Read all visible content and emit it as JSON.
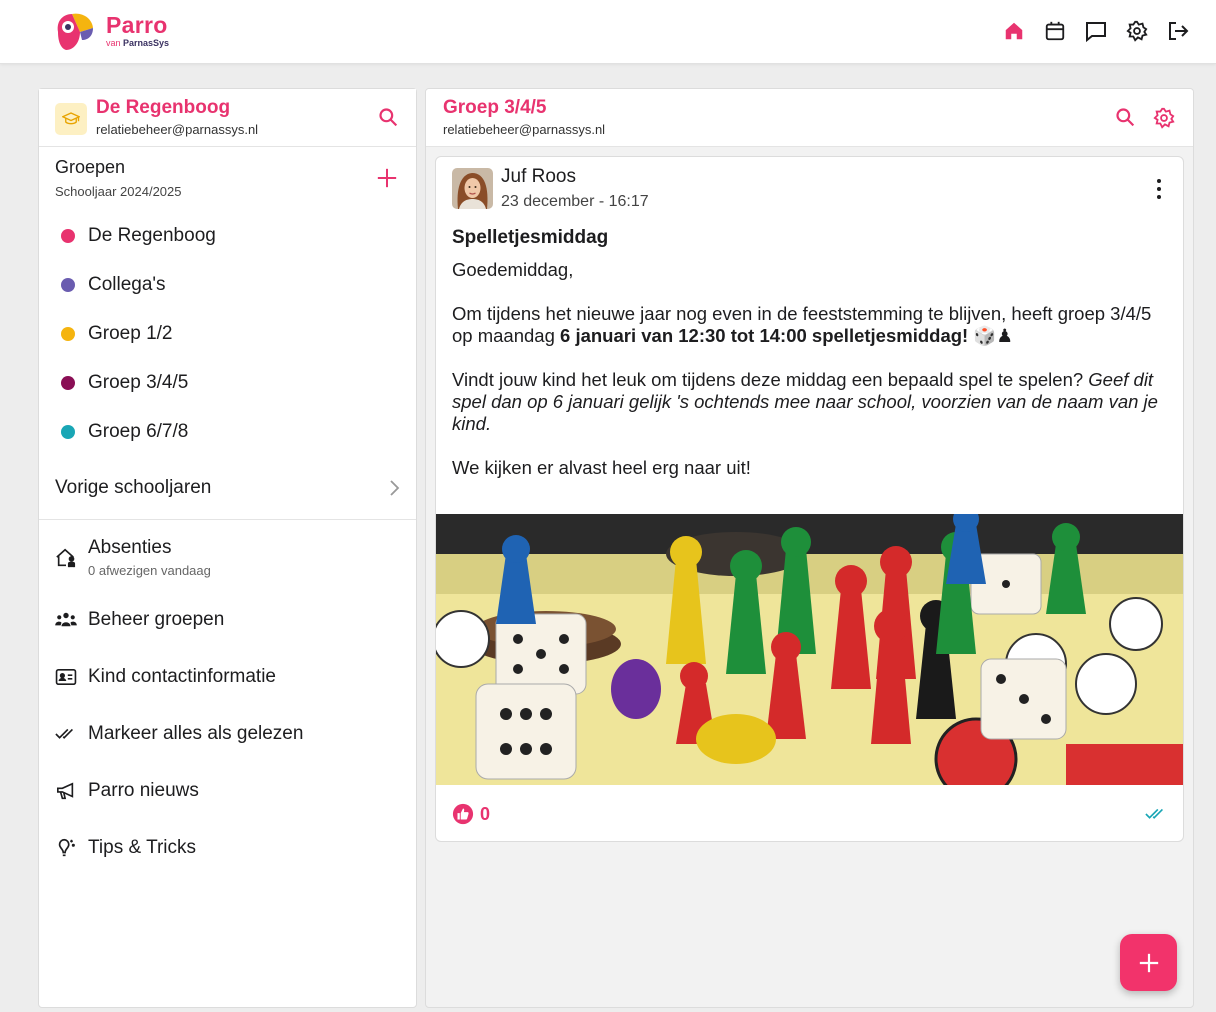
{
  "app": {
    "brand": "Parro",
    "brand_sub_prefix": "van",
    "brand_sub_strong": "ParnasSys",
    "accent_color": "#e8336f"
  },
  "topnav": [
    {
      "name": "home",
      "icon": "home-icon",
      "active": true
    },
    {
      "name": "calendar",
      "icon": "calendar-icon"
    },
    {
      "name": "chat",
      "icon": "chat-icon"
    },
    {
      "name": "settings",
      "icon": "gear-icon"
    },
    {
      "name": "logout",
      "icon": "logout-icon"
    }
  ],
  "school": {
    "title": "De Regenboog",
    "email": "relatiebeheer@parnassys.nl"
  },
  "groups": {
    "title": "Groepen",
    "year": "Schooljaar 2024/2025",
    "items": [
      {
        "label": "De Regenboog",
        "color": "#e8336f"
      },
      {
        "label": "Collega's",
        "color": "#6a5cb0"
      },
      {
        "label": "Groep 1/2",
        "color": "#f5b40f"
      },
      {
        "label": "Groep 3/4/5",
        "color": "#8a0e55"
      },
      {
        "label": "Groep 6/7/8",
        "color": "#19a6b5"
      }
    ],
    "previous_years": "Vorige schooljaren"
  },
  "menu": {
    "absences": "Absenties",
    "absences_sub": "0 afwezigen vandaag",
    "manage_groups": "Beheer groepen",
    "contact_info": "Kind contactinformatie",
    "mark_read": "Markeer alles als gelezen",
    "news": "Parro nieuws",
    "tips": "Tips & Tricks"
  },
  "group_header": {
    "title": "Groep 3/4/5",
    "email": "relatiebeheer@parnassys.nl"
  },
  "post": {
    "author": "Juf Roos",
    "date": "23 december - 16:17",
    "title": "Spelletjesmiddag",
    "greeting": "Goedemiddag,",
    "p1_start": "Om tijdens het nieuwe jaar nog even in de feeststemming te blijven, heeft groep 3/4/5 op maandag ",
    "p1_bold": "6 januari van 12:30 tot 14:00 spelletjesmiddag!",
    "p1_emoji": " 🎲♟",
    "p2_start": "Vindt jouw kind het leuk om tijdens deze middag een bepaald spel te spelen? ",
    "p2_italic": "Geef dit spel dan op 6 januari gelijk 's ochtends mee naar school, voorzien van de naam van je kind.",
    "p3": "We kijken er alvast heel erg naar uit!",
    "likes": "0"
  }
}
